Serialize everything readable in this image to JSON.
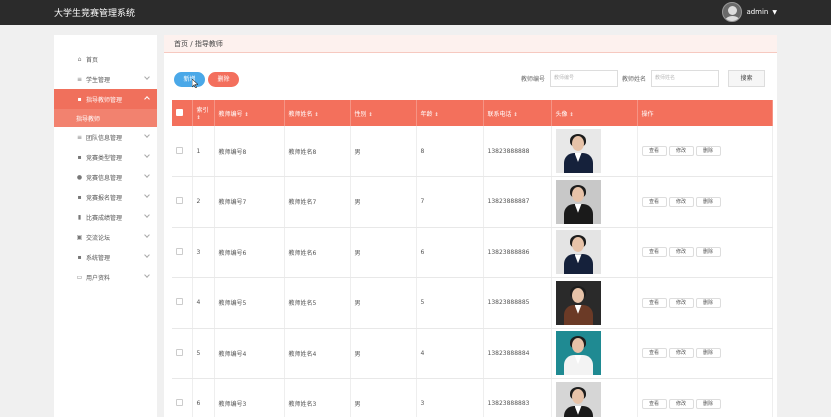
{
  "app": {
    "title": "大学生竞赛管理系统",
    "username": "admin"
  },
  "sidebar": {
    "items": [
      {
        "label": "首页",
        "icon": "home-icon",
        "glyph": "⌂",
        "has_chevron": false
      },
      {
        "label": "学生管理",
        "icon": "list-icon",
        "glyph": "≡",
        "has_chevron": true
      },
      {
        "label": "指导教师管理",
        "icon": "grid-icon",
        "glyph": "▪",
        "has_chevron": true,
        "active": true
      },
      {
        "label": "团队信息管理",
        "icon": "layers-icon",
        "glyph": "≡",
        "has_chevron": true
      },
      {
        "label": "竞赛类型管理",
        "icon": "grid-icon",
        "glyph": "▪",
        "has_chevron": true
      },
      {
        "label": "竞赛信息管理",
        "icon": "user-icon",
        "glyph": "●",
        "has_chevron": true
      },
      {
        "label": "竞赛报名管理",
        "icon": "grid-icon",
        "glyph": "▪",
        "has_chevron": true
      },
      {
        "label": "比赛成绩管理",
        "icon": "chart-icon",
        "glyph": "▮",
        "has_chevron": true
      },
      {
        "label": "交流论坛",
        "icon": "forum-icon",
        "glyph": "▣",
        "has_chevron": true
      },
      {
        "label": "系统管理",
        "icon": "grid-icon",
        "glyph": "▪",
        "has_chevron": true
      },
      {
        "label": "用户资料",
        "icon": "card-icon",
        "glyph": "▭",
        "has_chevron": true
      }
    ],
    "active_sub": "指导教师"
  },
  "breadcrumb": {
    "home": "首页",
    "sep": "/",
    "current": "指导教师"
  },
  "toolbar": {
    "add_label": "新增",
    "delete_label": "删除",
    "search_id_label": "教师编号",
    "search_id_placeholder": "教师编号",
    "search_name_label": "教师姓名",
    "search_name_placeholder": "教师姓名",
    "search_button": "搜索"
  },
  "table": {
    "headers": [
      "索引",
      "教师编号",
      "教师姓名",
      "性别",
      "年龄",
      "联系电话",
      "头像",
      "操作"
    ],
    "sort_glyph": "⇕",
    "actions": [
      "查看",
      "修改",
      "删除"
    ],
    "rows": [
      {
        "index": "1",
        "id": "教师编号8",
        "name": "教师姓名8",
        "gender": "男",
        "age": "8",
        "phone": "13823888888",
        "photo_bg": "#e8e8e8",
        "suit": "#15213b"
      },
      {
        "index": "2",
        "id": "教师编号7",
        "name": "教师姓名7",
        "gender": "男",
        "age": "7",
        "phone": "13823888887",
        "photo_bg": "#c8c8c8",
        "suit": "#1a1a1a"
      },
      {
        "index": "3",
        "id": "教师编号6",
        "name": "教师姓名6",
        "gender": "男",
        "age": "6",
        "phone": "13823888886",
        "photo_bg": "#e4e4e4",
        "suit": "#15213b"
      },
      {
        "index": "4",
        "id": "教师编号5",
        "name": "教师姓名5",
        "gender": "男",
        "age": "5",
        "phone": "13823888885",
        "photo_bg": "#2a2a2a",
        "suit": "#6b3a26"
      },
      {
        "index": "5",
        "id": "教师编号4",
        "name": "教师姓名4",
        "gender": "男",
        "age": "4",
        "phone": "13823888884",
        "photo_bg": "#1f8a92",
        "suit": "#f3f3f3"
      },
      {
        "index": "6",
        "id": "教师编号3",
        "name": "教师姓名3",
        "gender": "男",
        "age": "3",
        "phone": "13823888883",
        "photo_bg": "#d6d6d6",
        "suit": "#1a1a1a"
      }
    ]
  },
  "colors": {
    "accent": "#f3705c",
    "primary": "#4aa8e8",
    "topbar": "#2b2b2b"
  }
}
